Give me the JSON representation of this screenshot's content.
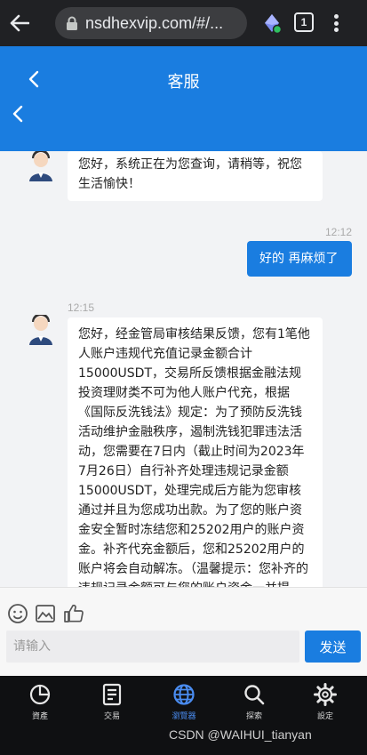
{
  "browser": {
    "url": "nsdhexvip.com/#/...",
    "tab_count": "1"
  },
  "header": {
    "title": "客服"
  },
  "chat": {
    "messages": [
      {
        "from": "agent",
        "text": "您好，系统正在为您查询，请稍等，祝您生活愉快！"
      },
      {
        "from": "me",
        "time": "12:12",
        "text": "好的 再麻烦了"
      },
      {
        "from": "agent",
        "time": "12:15",
        "text": "您好，经金管局审核结果反馈，您有1笔他人账户违规代充值记录金额合计15000USDT，交易所反馈根据金融法规投资理财类不可为他人账户代充，根据《国际反洗钱法》规定：为了预防反洗钱活动维护金融秩序，遏制洗钱犯罪违法活动，您需要在7日内（截止时间为2023年7月26日）自行补齐处理违规记录金额15000USDT，处理完成后方能为您审核通过并且为您成功出款。为了您的账户资金安全暂时冻结您和25202用户的账户资金。补齐代充金额后，您和25202用户的账户将会自动解冻。（温馨提示：您补齐的违规记录金额可与您的账户资金一并提现！）"
      }
    ]
  },
  "composer": {
    "placeholder": "请输入",
    "send_label": "发送",
    "tools": [
      "emoji-icon",
      "image-icon",
      "thumbs-up-icon"
    ]
  },
  "nav": [
    {
      "label": "資產",
      "icon": "pie-chart-icon",
      "active": false
    },
    {
      "label": "交易",
      "icon": "document-icon",
      "active": false
    },
    {
      "label": "瀏覽器",
      "icon": "globe-icon",
      "active": true
    },
    {
      "label": "探索",
      "icon": "search-icon",
      "active": false
    },
    {
      "label": "設定",
      "icon": "gear-icon",
      "active": false
    }
  ],
  "watermark": "CSDN @WAIHUI_tianyan",
  "colors": {
    "brand": "#1a7de0",
    "chrome": "#202124",
    "nav_active": "#4a8cf0"
  }
}
